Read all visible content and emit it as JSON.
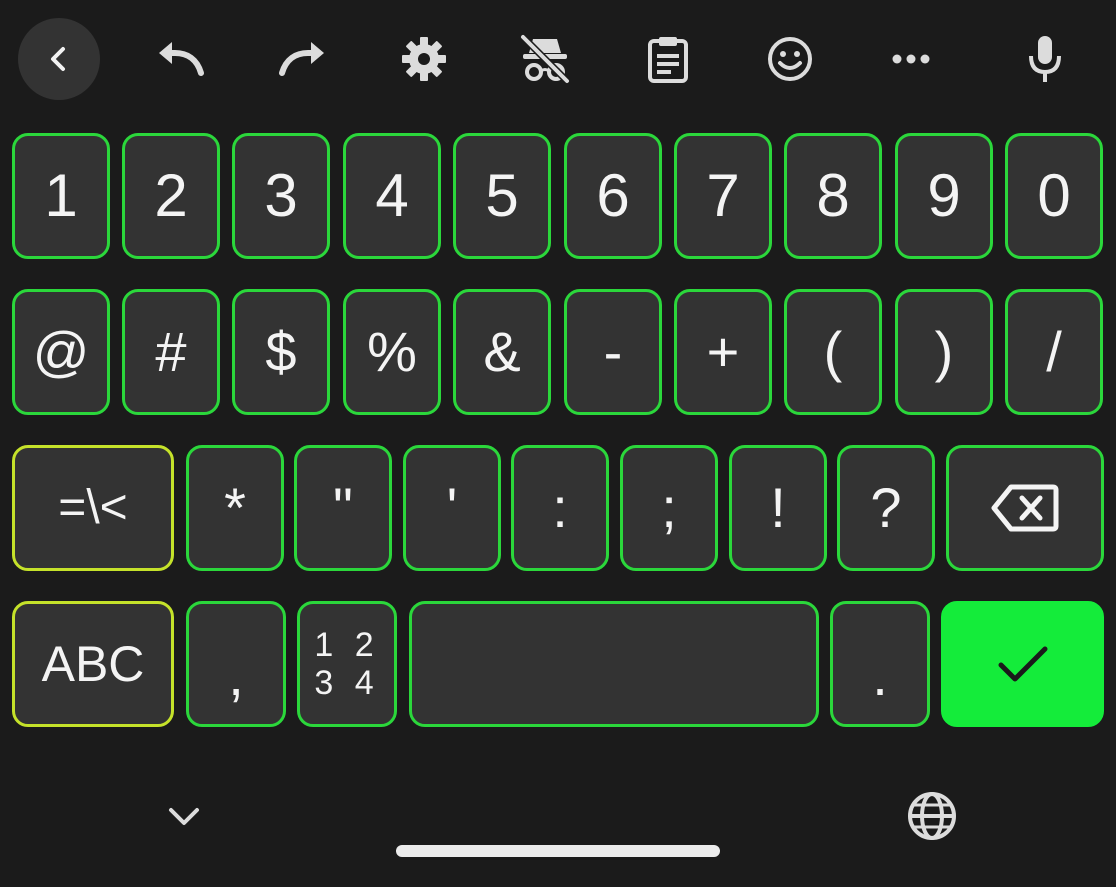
{
  "toolbar": {
    "icons": [
      "back-icon",
      "undo-icon",
      "redo-icon",
      "settings-icon",
      "incognito-off-icon",
      "clipboard-icon",
      "emoji-icon",
      "more-icon",
      "mic-icon"
    ]
  },
  "keyboard": {
    "row1": [
      "1",
      "2",
      "3",
      "4",
      "5",
      "6",
      "7",
      "8",
      "9",
      "0"
    ],
    "row2": [
      "@",
      "#",
      "$",
      "%",
      "&",
      "-",
      "+",
      "(",
      ")",
      "/"
    ],
    "row3": {
      "more_symbols": "=\\<",
      "keys": [
        "*",
        "\"",
        "'",
        ":",
        ";",
        "!",
        "?"
      ]
    },
    "row4": {
      "abc": "ABC",
      "comma": ",",
      "numpad_line1": "1 2",
      "numpad_line2": "3 4",
      "period": "."
    }
  },
  "colors": {
    "background": "#1b1b1b",
    "key": "#333333",
    "key_border": "#2bd73b",
    "modifier_border": "#c5e22a",
    "enter": "#14ec3a"
  },
  "nav": {
    "icons": [
      "chevron-down-icon",
      "globe-icon"
    ]
  }
}
